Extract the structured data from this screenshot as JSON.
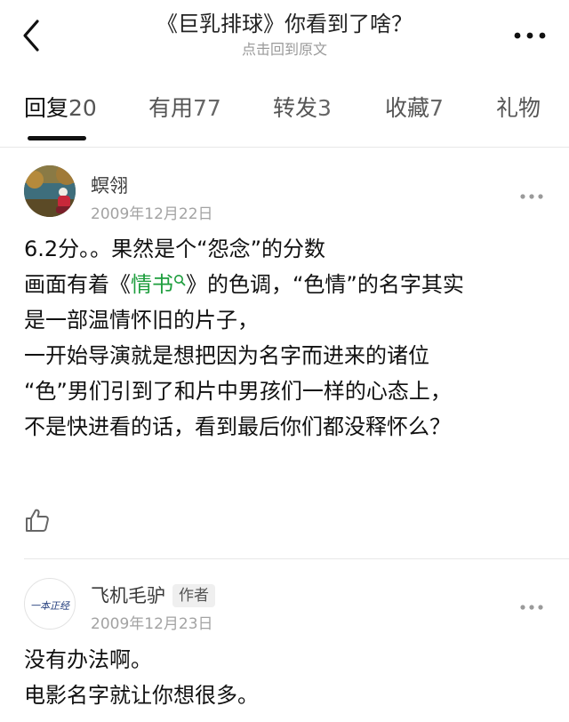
{
  "header": {
    "title": "《巨乳排球》你看到了啥？",
    "subtitle": "点击回到原文"
  },
  "tabs": [
    {
      "label": "回复",
      "count": "20",
      "active": true
    },
    {
      "label": "有用",
      "count": "77",
      "active": false
    },
    {
      "label": "转发",
      "count": "3",
      "active": false
    },
    {
      "label": "收藏",
      "count": "7",
      "active": false
    },
    {
      "label": "礼物",
      "count": "",
      "active": false
    }
  ],
  "comments": [
    {
      "author": "螟翎",
      "date": "2009年12月22日",
      "lines": {
        "l1": "6.2分。。果然是个“怨念”的分数",
        "l2_prefix": "画面有着《",
        "l2_link": "情书",
        "l2_suffix": "》的色调，“色情”的名字其实",
        "l3": "是一部温情怀旧的片子，",
        "l4": "一开始导演就是想把因为名字而进来的诸位",
        "l5": "“色”男们引到了和片中男孩们一样的心态上，",
        "l6": "不是快进看的话，看到最后你们都没释怀么？"
      }
    },
    {
      "author": "飞机毛驴",
      "badge": "作者",
      "avatar_text": "一本正经",
      "date": "2009年12月23日",
      "lines": {
        "l1": "没有办法啊。",
        "l2": "电影名字就让你想很多。"
      }
    }
  ],
  "colors": {
    "link": "#1e9e3e",
    "secondary_text": "#a3a3a3",
    "divider": "#e7e7e7"
  },
  "icons": {
    "back": "chevron-left-icon",
    "more": "more-horizontal-icon",
    "like": "thumbs-up-icon",
    "search": "search-icon"
  }
}
